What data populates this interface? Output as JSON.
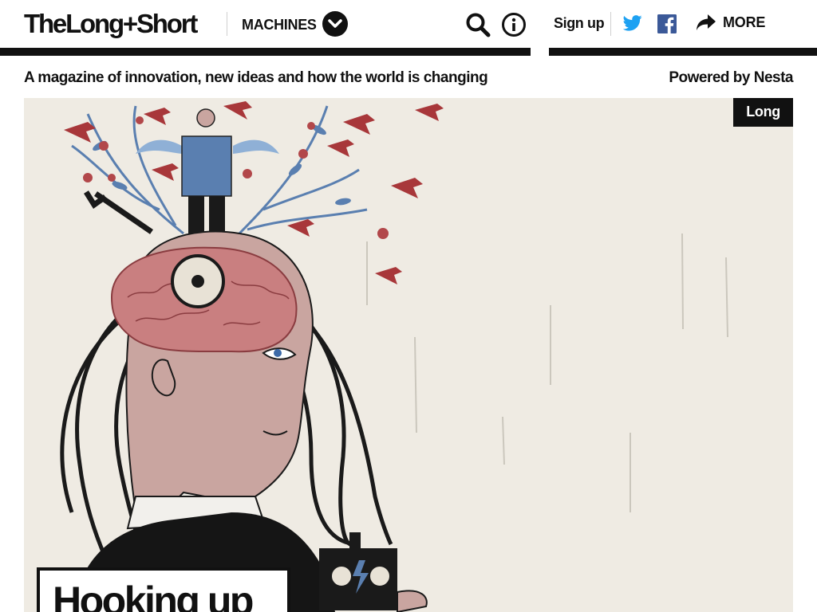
{
  "header": {
    "logo": "TheLong+Short",
    "section_label": "MACHINES",
    "icons": {
      "section_toggle": "chevron-down-icon",
      "search": "search-icon",
      "info": "info-icon",
      "twitter": "twitter-icon",
      "facebook": "facebook-icon",
      "share": "share-arrow-icon"
    },
    "signup_label": "Sign up",
    "more_label": "MORE"
  },
  "tagline": "A magazine of innovation, new ideas and how the world is changing",
  "powered_by": "Powered by Nesta",
  "hero": {
    "badge": "Long",
    "headline": "Hooking up"
  },
  "colors": {
    "text": "#111111",
    "twitter": "#1DA1F2",
    "facebook": "#3B5998",
    "hero_bg": "#efebe3",
    "bird_red": "#a8373a",
    "vine_blue": "#5a7fb0",
    "skin": "#c9a5a0"
  }
}
